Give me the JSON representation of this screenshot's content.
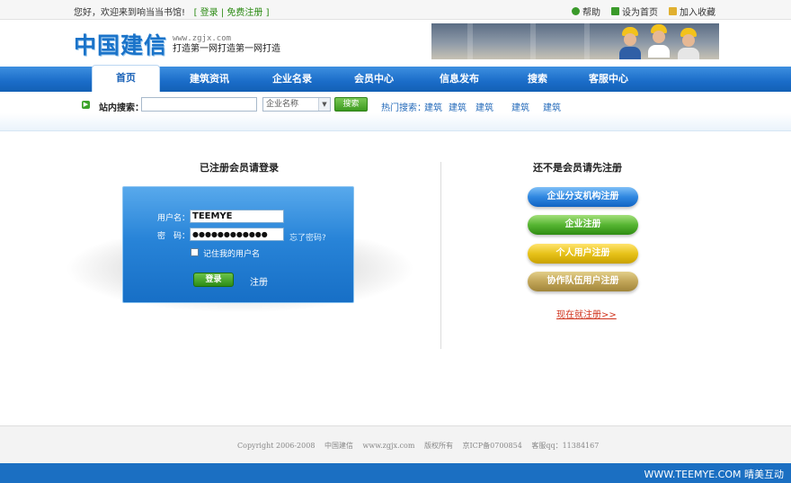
{
  "topbar": {
    "greeting": "您好，欢迎来到响当当书馆!",
    "bracket_open": "[",
    "login": "登录",
    "sep": "|",
    "register_free": "免费注册",
    "bracket_close": "]",
    "help": "帮助",
    "set_home": "设为首页",
    "add_favorite": "加入收藏"
  },
  "header": {
    "logo_text": "中国建信",
    "domain": "www.zgjx.com",
    "slogan": "打造第一网打造第一网打造"
  },
  "nav": {
    "items": [
      "首页",
      "建筑资讯",
      "企业名录",
      "会员中心",
      "信息发布",
      "搜索",
      "客服中心"
    ],
    "active_index": 0
  },
  "search": {
    "label": "站内搜索：",
    "input_value": "",
    "select_value": "企业名称",
    "button": "搜索",
    "hot_label": "热门搜索：",
    "hot_keywords": [
      "建筑",
      "建筑",
      "建筑",
      "建筑",
      "建筑"
    ]
  },
  "login": {
    "heading": "已注册会员请登录",
    "username_label": "用户名：",
    "username_value": "TEEMYE",
    "password_label": "密　码：",
    "password_value": "●●●●●●●●●●●●",
    "forgot": "忘了密码?",
    "remember": "记住我的用户名",
    "login_button": "登录",
    "register_link": "注册"
  },
  "register": {
    "heading": "还不是会员请先注册",
    "options": [
      "企业分支机构注册",
      "企业注册",
      "个人用户注册",
      "协作队伍用户注册"
    ],
    "register_now": "现在就注册>>"
  },
  "footer": {
    "copyright": "Copyright 2006-2008",
    "brand": "中国建信",
    "domain": "www.zgjx.com",
    "rights": "版权所有",
    "icp": "京ICP备0700854",
    "service": "客服qq：11384167"
  },
  "watermark": {
    "text": "WWW.TEEMYE.COM  晴美互动"
  },
  "colors": {
    "nav_blue": "#1a6cc8",
    "link_green": "#2a8a12",
    "link_blue": "#2168b9",
    "accent_red": "#d0331c"
  }
}
